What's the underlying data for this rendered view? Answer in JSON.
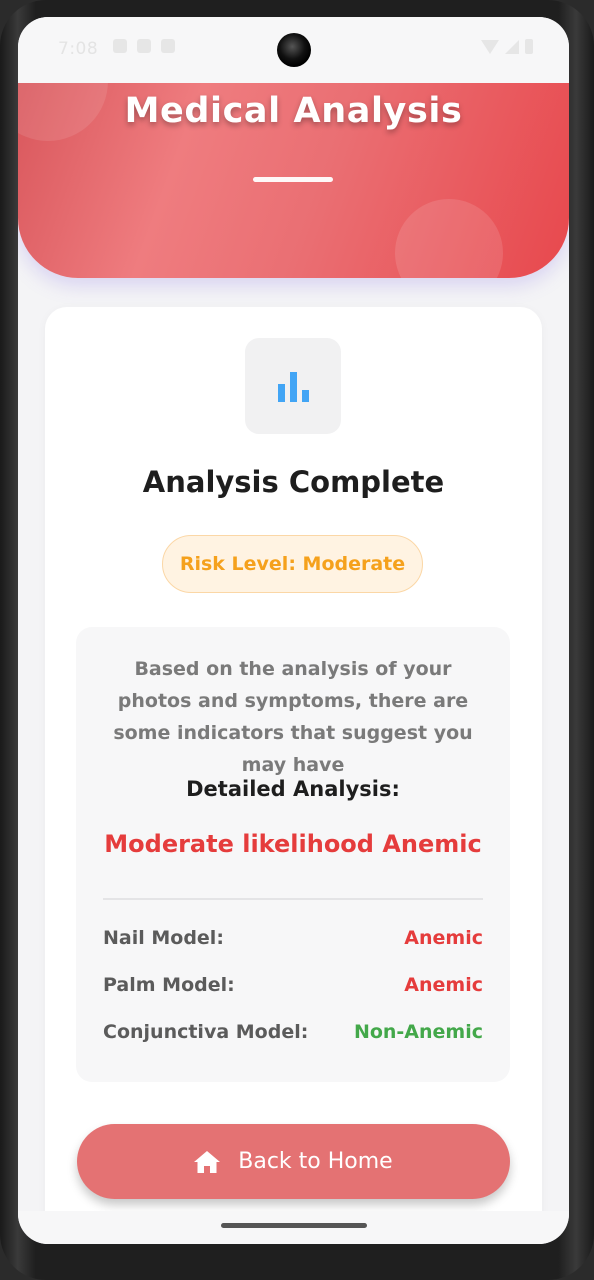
{
  "status": {
    "time": "7:08"
  },
  "header": {
    "title": "Medical Analysis"
  },
  "card": {
    "heading": "Analysis Complete",
    "risk_label": "Risk Level: Moderate",
    "summary": "Based on the analysis of your photos and symptoms, there are some indicators that suggest you may have",
    "detail_title": "Detailed Analysis:",
    "result": "Moderate likelihood Anemic",
    "models": [
      {
        "label": "Nail Model:",
        "value": "Anemic"
      },
      {
        "label": "Palm Model:",
        "value": "Anemic"
      },
      {
        "label": "Conjunctiva Model:",
        "value": "Non-Anemic"
      }
    ],
    "home_button": "Back to Home"
  },
  "colors": {
    "accent": "#e8484d",
    "risk_moderate": "#f5a11c",
    "anemic": "#e53c3c",
    "non_anemic": "#43a84a",
    "chart_icon": "#42a5f5"
  },
  "icons": {
    "result_icon": "bar-chart-icon",
    "home_icon": "home-icon"
  }
}
